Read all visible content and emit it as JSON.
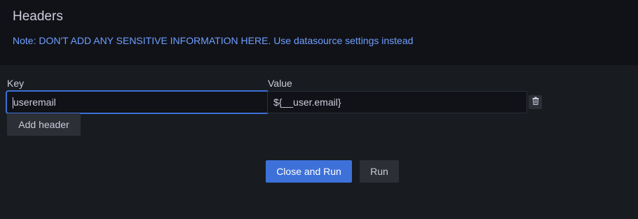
{
  "panel": {
    "title": "Headers",
    "note": "Note: DON'T ADD ANY SENSITIVE INFORMATION HERE. Use datasource settings instead"
  },
  "headers": {
    "key_label": "Key",
    "value_label": "Value",
    "rows": [
      {
        "key": "useremail",
        "value": "${__user.email}"
      }
    ],
    "add_label": "Add header",
    "delete_icon": "trash-icon"
  },
  "actions": {
    "close_and_run_label": "Close and Run",
    "run_label": "Run"
  },
  "colors": {
    "background": "#181b1f",
    "header_background": "#111217",
    "note": "#6e9fff",
    "primary": "#3d71d9",
    "secondary": "#2c2f35",
    "text": "#ccccdc"
  }
}
